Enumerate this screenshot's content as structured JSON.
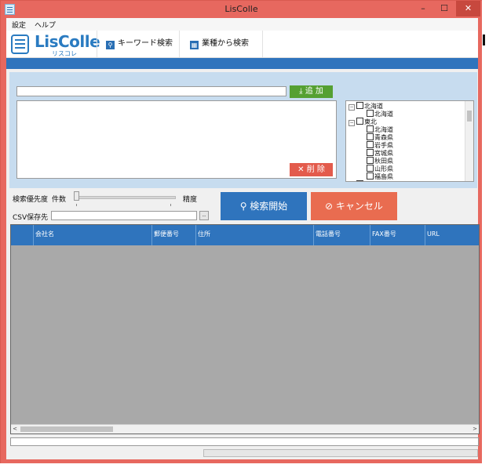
{
  "window": {
    "title": "LisColle",
    "minimize": "–",
    "maximize": "☐",
    "close": "✕"
  },
  "menu": {
    "settings": "設定",
    "help": "ヘルプ"
  },
  "logo": {
    "name": "LisColle",
    "sub": "リスコレ"
  },
  "toolbar": {
    "keyword_search": "キーワード検索",
    "industry_search": "業種から検索"
  },
  "keyword": {
    "input_value": "",
    "add_label": "追 加",
    "delete_label": "削 除"
  },
  "tree": [
    {
      "label": "北海道",
      "level": 0,
      "expander": "−"
    },
    {
      "label": "北海道",
      "level": 1
    },
    {
      "label": "東北",
      "level": 0,
      "expander": "−"
    },
    {
      "label": "北海道",
      "level": 1
    },
    {
      "label": "青森県",
      "level": 1
    },
    {
      "label": "岩手県",
      "level": 1
    },
    {
      "label": "宮城県",
      "level": 1
    },
    {
      "label": "秋田県",
      "level": 1
    },
    {
      "label": "山形県",
      "level": 1
    },
    {
      "label": "福島県",
      "level": 1
    },
    {
      "label": "関東",
      "level": 0,
      "expander": "+"
    }
  ],
  "priority": {
    "label": "検索優先度",
    "left": "件数",
    "right": "精度"
  },
  "csv": {
    "label": "CSV保存先",
    "browse": "..",
    "value": ""
  },
  "actions": {
    "search": "検索開始",
    "cancel": "キャンセル"
  },
  "grid": {
    "columns": [
      "",
      "会社名",
      "郵便番号",
      "住所",
      "電話番号",
      "FAX番号",
      "URL"
    ],
    "scroll_left": "<",
    "scroll_right": ">"
  },
  "progress": {
    "value": 0
  },
  "colors": {
    "accent": "#2f74bd",
    "add": "#55a032",
    "delete": "#e35b4c",
    "cancel": "#e96c50",
    "titlebar": "#e7685f"
  }
}
